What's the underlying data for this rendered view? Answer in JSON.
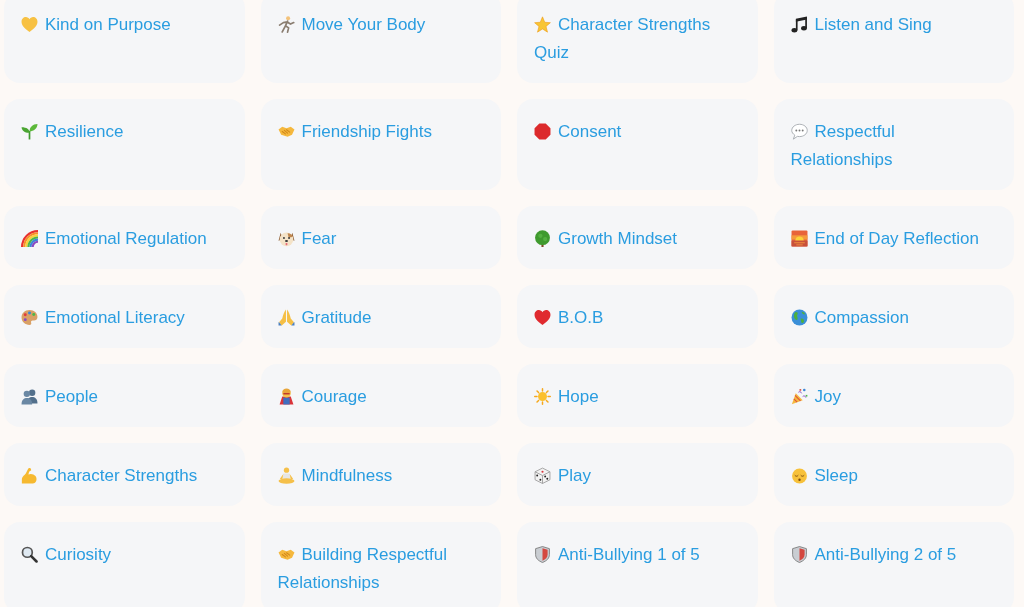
{
  "topics": [
    {
      "title": "Kind on Purpose",
      "kind": "goldheart"
    },
    {
      "title": "Move Your Body",
      "kind": "runner"
    },
    {
      "title": "Character Strengths Quiz",
      "kind": "star"
    },
    {
      "title": "Listen and Sing",
      "kind": "notes"
    },
    {
      "title": "Resilience",
      "kind": "sprout"
    },
    {
      "title": "Friendship Fights",
      "kind": "handshake"
    },
    {
      "title": "Consent",
      "kind": "stop"
    },
    {
      "title": "Respectful Relationships",
      "kind": "speech"
    },
    {
      "title": "Emotional Regulation",
      "kind": "rainbow"
    },
    {
      "title": "Fear",
      "kind": "dog"
    },
    {
      "title": "Growth Mindset",
      "kind": "tree"
    },
    {
      "title": "End of Day Reflection",
      "kind": "sunset"
    },
    {
      "title": "Emotional Literacy",
      "kind": "palette"
    },
    {
      "title": "Gratitude",
      "kind": "prayer"
    },
    {
      "title": "B.O.B",
      "kind": "redheart"
    },
    {
      "title": "Compassion",
      "kind": "globe"
    },
    {
      "title": "People",
      "kind": "busts"
    },
    {
      "title": "Courage",
      "kind": "hero"
    },
    {
      "title": "Hope",
      "kind": "sun"
    },
    {
      "title": "Joy",
      "kind": "party"
    },
    {
      "title": "Character Strengths",
      "kind": "muscle"
    },
    {
      "title": "Mindfulness",
      "kind": "meditation"
    },
    {
      "title": "Play",
      "kind": "dice"
    },
    {
      "title": "Sleep",
      "kind": "sleepy"
    },
    {
      "title": "Curiosity",
      "kind": "magnifier"
    },
    {
      "title": "Building Respectful Relationships",
      "kind": "handshake"
    },
    {
      "title": "Anti-Bullying 1 of 5",
      "kind": "shield"
    },
    {
      "title": "Anti-Bullying 2 of 5",
      "kind": "shield"
    }
  ]
}
